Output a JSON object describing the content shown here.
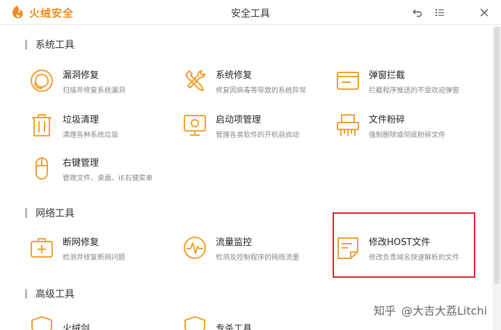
{
  "app": {
    "logo_text": "火绒安全",
    "window_title": "安全工具"
  },
  "window_controls": {
    "back_icon": "back-arrow-icon",
    "menu_icon": "menu-icon",
    "close_icon": "close-icon"
  },
  "colors": {
    "accent": "#f0a030",
    "brand": "#f08a1d",
    "highlight": "#d9232d"
  },
  "sections": {
    "system": {
      "title": "系统工具",
      "tools": [
        {
          "name": "漏洞修复",
          "desc": "扫描并修复系统漏洞",
          "icon": "vulnerability-fix-icon"
        },
        {
          "name": "系统修复",
          "desc": "修复因病毒等导致的系统异常",
          "icon": "system-repair-icon"
        },
        {
          "name": "弹窗拦截",
          "desc": "拦截程序推送的不受欢迎弹窗",
          "icon": "popup-block-icon"
        },
        {
          "name": "垃圾清理",
          "desc": "清理各种系统垃圾",
          "icon": "trash-clean-icon"
        },
        {
          "name": "启动项管理",
          "desc": "管理各类软件的开机自启动",
          "icon": "startup-manager-icon"
        },
        {
          "name": "文件粉碎",
          "desc": "强制删除或彻底粉碎文件",
          "icon": "file-shredder-icon"
        },
        {
          "name": "右键管理",
          "desc": "管理文件、桌面、IE右键菜单",
          "icon": "right-click-mouse-icon"
        }
      ]
    },
    "network": {
      "title": "网络工具",
      "tools": [
        {
          "name": "断网修复",
          "desc": "检测并修复断网问题",
          "icon": "network-repair-icon"
        },
        {
          "name": "流量监控",
          "desc": "检测及控制程序的网络流量",
          "icon": "traffic-monitor-icon"
        },
        {
          "name": "修改HOST文件",
          "desc": "修改负责域名快速解析的文件",
          "icon": "host-file-icon"
        }
      ]
    },
    "advanced": {
      "title": "高级工具",
      "tools": [
        {
          "name": "火绒剑",
          "icon": "shield-sword-icon"
        },
        {
          "name": "专杀工具",
          "icon": "special-kill-icon"
        }
      ]
    }
  },
  "watermark": {
    "site": "知乎",
    "author": "@大吉大荔Litchi"
  }
}
